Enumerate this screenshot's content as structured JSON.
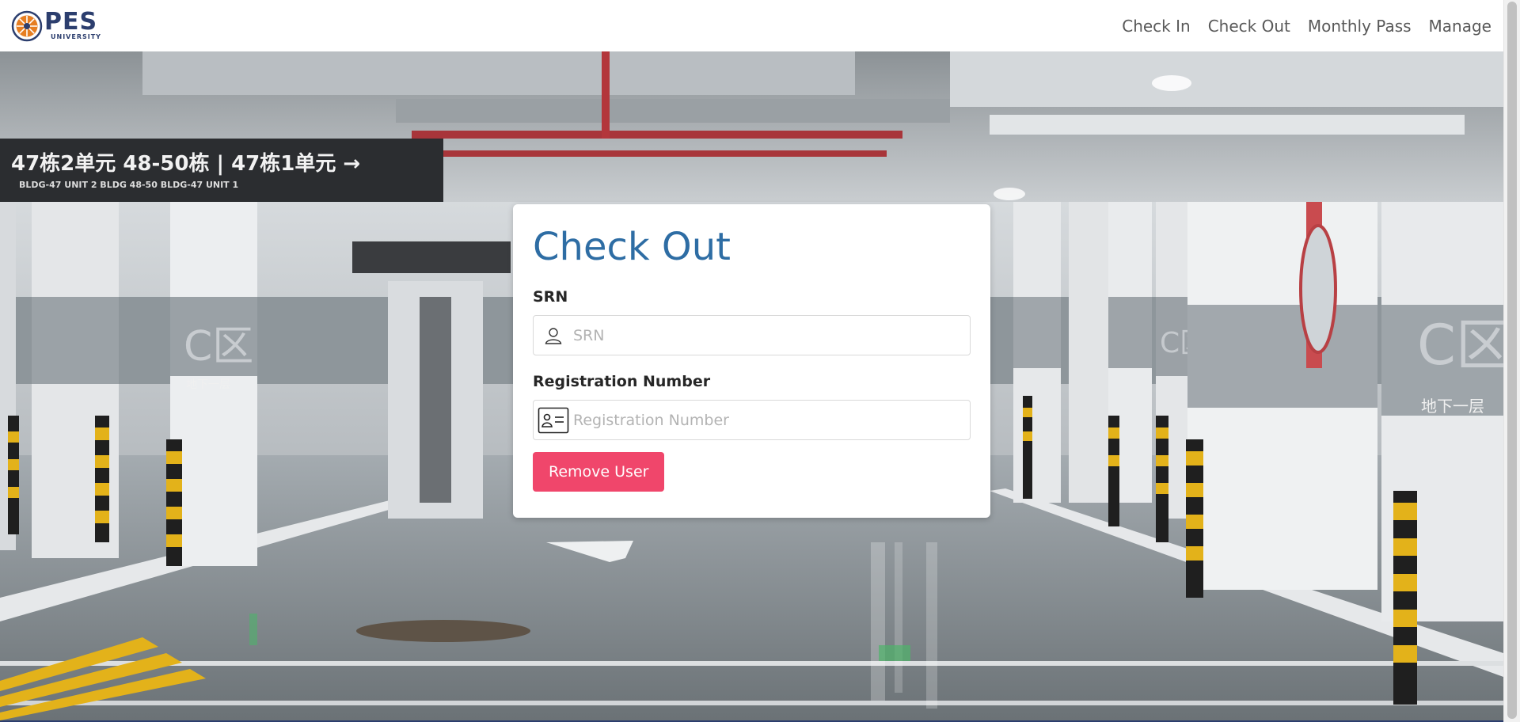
{
  "brand": {
    "name": "PES",
    "subtitle": "UNIVERSITY",
    "emblem_icon": "sun-emblem-icon",
    "color": "#2c3e6e",
    "accent": "#e67e22"
  },
  "nav": {
    "items": [
      {
        "label": "Check In"
      },
      {
        "label": "Check Out"
      },
      {
        "label": "Monthly Pass"
      },
      {
        "label": "Manage"
      }
    ]
  },
  "form": {
    "title": "Check Out",
    "title_color": "#2e6da4",
    "srn": {
      "label": "SRN",
      "placeholder": "SRN",
      "value": "",
      "icon": "person-icon"
    },
    "registration": {
      "label": "Registration Number",
      "placeholder": "Registration Number",
      "value": "",
      "icon": "id-card-icon"
    },
    "submit_label": "Remove User",
    "submit_color": "#f0466b"
  },
  "background": {
    "scene": "underground-parking-garage",
    "signs": {
      "left_sign": "47栋2单元 48-50栋 | 47栋1单元",
      "left_sign_sub": "BLDG-47 UNIT 2   BLDG 48-50   BLDG-47 UNIT 1",
      "pillar_label": "C区",
      "floor_label": "地下一层"
    }
  }
}
